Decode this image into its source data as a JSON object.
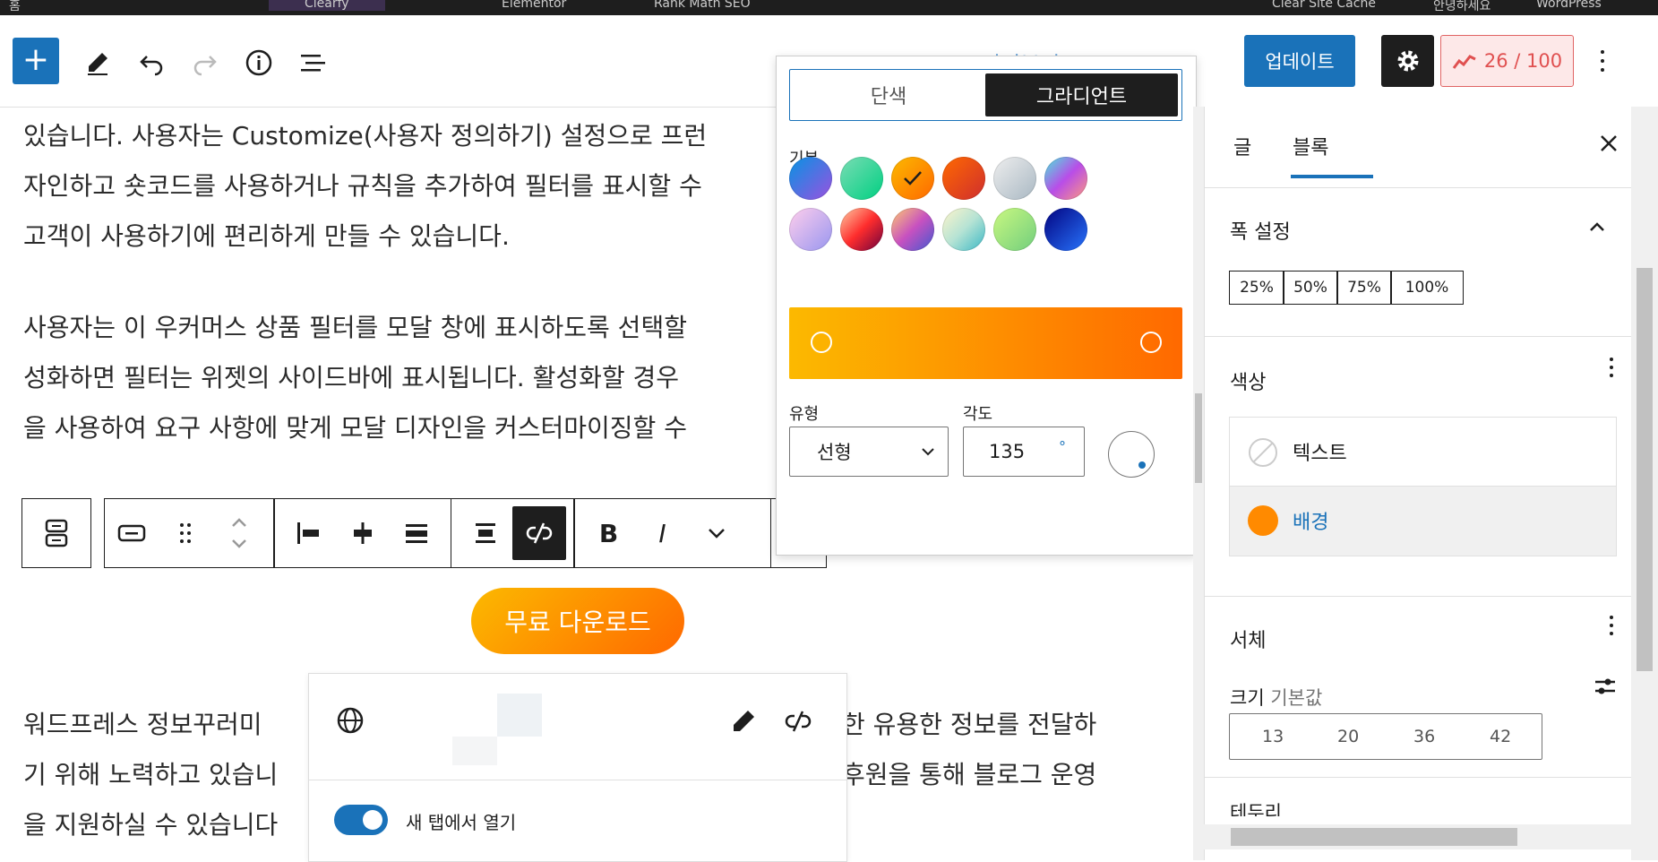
{
  "topbar": {
    "items": [
      "홈",
      "Clearfy",
      "Elementor",
      "Rank Math SEO",
      "Clear Site Cache",
      "안녕하세요",
      "WordPress"
    ]
  },
  "header": {
    "add_label": "+",
    "faded_link": "미리보기",
    "update_label": "업데이트",
    "seo_score": "26 / 100",
    "icons": [
      "add-icon",
      "pen-icon",
      "undo-icon",
      "redo-icon",
      "info-icon",
      "list-view-icon",
      "gear-icon",
      "more-icon"
    ]
  },
  "content": {
    "paragraphs": [
      [
        "있습니다. 사용자는 Customize(사용자 정의하기) 설정으로 프런",
        "자인하고 숏코드를 사용하거나 규칙을 추가하여 필터를 표시할 수",
        "고객이 사용하기에 편리하게 만들 수 있습니다."
      ],
      [
        "사용자는 이 우커머스 상품 필터를 모달 창에 표시하도록 선택할",
        "성화하면 필터는 위젯의 사이드바에 표시됩니다. 활성화할 경우",
        "을 사용하여 요구 사항에 맞게 모달 디자인을 커스터마이징할 수"
      ],
      [
        "워드프레스 정보꾸러미",
        "한 유용한 정보를 전달하",
        "기 위해 노력하고 있습니",
        "후원을 통해 블로그 운영",
        "을 지원하실 수 있습니다"
      ]
    ],
    "download_button": "무료 다운로드"
  },
  "block_toolbar": {
    "bold": "B",
    "italic": "I"
  },
  "link_popover": {
    "new_tab_label": "새 탭에서 열기",
    "new_tab_on": true
  },
  "color_popover": {
    "tabs": [
      "단색",
      "그라디언트"
    ],
    "active_tab": "그라디언트",
    "section_label": "기본",
    "swatches": [
      {
        "name": "vivid-cyan-blue-to-vivid-purple",
        "from": "#0693e3",
        "to": "#9b51e0",
        "selected": false
      },
      {
        "name": "light-green-cyan-to-vivid-green-cyan",
        "from": "#7adcb4",
        "to": "#00d082",
        "selected": false
      },
      {
        "name": "luminous-vivid-amber-to-luminous-vivid-orange",
        "from": "#fcb900",
        "to": "#ff6900",
        "selected": true
      },
      {
        "name": "luminous-vivid-orange-to-vivid-red",
        "from": "#ff6900",
        "to": "#cf2e2e",
        "selected": false
      },
      {
        "name": "very-light-gray-to-cyan-bluish-gray",
        "from": "#eeeeee",
        "to": "#a9b8c3",
        "selected": false
      },
      {
        "name": "cool-to-warm-spectrum",
        "from": "#4aeadc",
        "to": "#fe9a7d",
        "mid": "#b84de8",
        "selected": false
      },
      {
        "name": "blush-light-purple",
        "from": "#ffceec",
        "to": "#9896f0",
        "selected": false
      },
      {
        "name": "blush-bordeaux",
        "from": "#fecda5",
        "to": "#6b003e",
        "mid": "#fe2d2d",
        "selected": false
      },
      {
        "name": "luminous-dusk",
        "from": "#ffcb70",
        "to": "#4158d0",
        "mid": "#c751c0",
        "selected": false
      },
      {
        "name": "pale-ocean",
        "from": "#fff5cb",
        "to": "#3ab8c6",
        "mid": "#b6e3d4",
        "selected": false
      },
      {
        "name": "electric-grass",
        "from": "#caf880",
        "to": "#71ce7e",
        "selected": false
      },
      {
        "name": "midnight",
        "from": "#020381",
        "to": "#2874fc",
        "selected": false
      }
    ],
    "gradient": {
      "from": "#fcb900",
      "to": "#ff6900"
    },
    "type_label": "유형",
    "type_value": "선형",
    "angle_label": "각도",
    "angle_value": "135",
    "angle_unit": "°"
  },
  "sidebar": {
    "tabs": [
      "글",
      "블록"
    ],
    "active_tab": "블록",
    "width_panel": {
      "title": "폭 설정",
      "options": [
        "25%",
        "50%",
        "75%",
        "100%"
      ]
    },
    "color_panel": {
      "title": "색상",
      "items": [
        {
          "label": "텍스트",
          "color": "none"
        },
        {
          "label": "배경",
          "color": "#ff8a00"
        }
      ]
    },
    "typography_panel": {
      "title": "서체",
      "size_label": "크기",
      "size_value": "기본값",
      "sizes": [
        "13",
        "20",
        "36",
        "42"
      ]
    },
    "next_panel_partial": "테두리"
  }
}
